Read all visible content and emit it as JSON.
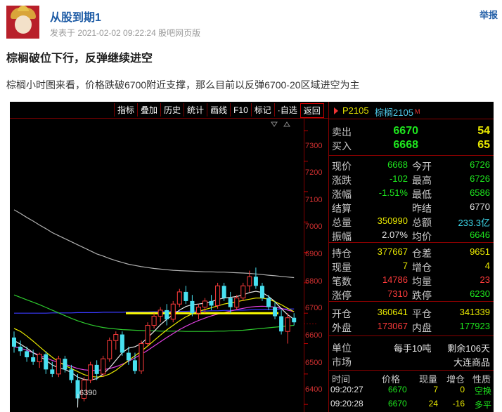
{
  "post": {
    "username": "从股到期1",
    "meta": "发表于 2021-02-02 09:22:24 股吧网页版",
    "report": "举报",
    "title": "棕榈破位下行，反弹继续进空",
    "content": "棕榈小时图来看，价格跌破6700附近支撑，那么目前以反弹6700-20区域进空为主"
  },
  "chart": {
    "toolbar": [
      "指标",
      "叠加",
      "历史",
      "统计",
      "画线",
      "F10",
      "标记",
      "·自选",
      "返回"
    ],
    "active_tool": "返回",
    "y_ticks": [
      "7300",
      "7200",
      "7100",
      "7000",
      "6900",
      "6800",
      "6700",
      "6600",
      "6500",
      "6400"
    ],
    "low_marker": "6390",
    "colors": {
      "bg": "#000000",
      "up": "#ff3b3b",
      "down": "#48e0f0",
      "grid": "#800000",
      "support": "#ffff00"
    }
  },
  "chart_data": {
    "type": "candlestick",
    "y_ticks": [
      7300,
      7200,
      7100,
      7000,
      6900,
      6800,
      6700,
      6600,
      6500,
      6400
    ],
    "ylim": [
      6375,
      7340
    ],
    "support_line": 6700,
    "low_annotation": 6390,
    "candles": [
      {
        "o": 6620,
        "h": 6640,
        "l": 6570,
        "c": 6590
      },
      {
        "o": 6590,
        "h": 6610,
        "l": 6560,
        "c": 6575
      },
      {
        "o": 6575,
        "h": 6590,
        "l": 6540,
        "c": 6555
      },
      {
        "o": 6555,
        "h": 6580,
        "l": 6530,
        "c": 6540
      },
      {
        "o": 6540,
        "h": 6570,
        "l": 6520,
        "c": 6565
      },
      {
        "o": 6565,
        "h": 6575,
        "l": 6500,
        "c": 6515
      },
      {
        "o": 6515,
        "h": 6540,
        "l": 6490,
        "c": 6500
      },
      {
        "o": 6500,
        "h": 6560,
        "l": 6490,
        "c": 6550
      },
      {
        "o": 6550,
        "h": 6560,
        "l": 6505,
        "c": 6515
      },
      {
        "o": 6515,
        "h": 6530,
        "l": 6470,
        "c": 6480
      },
      {
        "o": 6480,
        "h": 6500,
        "l": 6390,
        "c": 6420
      },
      {
        "o": 6420,
        "h": 6490,
        "l": 6410,
        "c": 6480
      },
      {
        "o": 6480,
        "h": 6540,
        "l": 6470,
        "c": 6530
      },
      {
        "o": 6530,
        "h": 6545,
        "l": 6480,
        "c": 6500
      },
      {
        "o": 6500,
        "h": 6560,
        "l": 6490,
        "c": 6550
      },
      {
        "o": 6550,
        "h": 6620,
        "l": 6540,
        "c": 6610
      },
      {
        "o": 6610,
        "h": 6640,
        "l": 6580,
        "c": 6630
      },
      {
        "o": 6630,
        "h": 6640,
        "l": 6560,
        "c": 6570
      },
      {
        "o": 6570,
        "h": 6590,
        "l": 6530,
        "c": 6545
      },
      {
        "o": 6545,
        "h": 6570,
        "l": 6500,
        "c": 6510
      },
      {
        "o": 6510,
        "h": 6610,
        "l": 6500,
        "c": 6600
      },
      {
        "o": 6600,
        "h": 6670,
        "l": 6590,
        "c": 6660
      },
      {
        "o": 6660,
        "h": 6700,
        "l": 6650,
        "c": 6690
      },
      {
        "o": 6690,
        "h": 6720,
        "l": 6670,
        "c": 6710
      },
      {
        "o": 6710,
        "h": 6730,
        "l": 6660,
        "c": 6680
      },
      {
        "o": 6680,
        "h": 6740,
        "l": 6670,
        "c": 6730
      },
      {
        "o": 6730,
        "h": 6780,
        "l": 6720,
        "c": 6770
      },
      {
        "o": 6770,
        "h": 6790,
        "l": 6730,
        "c": 6740
      },
      {
        "o": 6740,
        "h": 6760,
        "l": 6690,
        "c": 6700
      },
      {
        "o": 6700,
        "h": 6730,
        "l": 6680,
        "c": 6720
      },
      {
        "o": 6720,
        "h": 6750,
        "l": 6700,
        "c": 6740
      },
      {
        "o": 6740,
        "h": 6760,
        "l": 6710,
        "c": 6725
      },
      {
        "o": 6725,
        "h": 6800,
        "l": 6715,
        "c": 6790
      },
      {
        "o": 6790,
        "h": 6800,
        "l": 6740,
        "c": 6750
      },
      {
        "o": 6750,
        "h": 6770,
        "l": 6700,
        "c": 6720
      },
      {
        "o": 6720,
        "h": 6760,
        "l": 6710,
        "c": 6750
      },
      {
        "o": 6750,
        "h": 6800,
        "l": 6740,
        "c": 6790
      },
      {
        "o": 6790,
        "h": 6840,
        "l": 6770,
        "c": 6820
      },
      {
        "o": 6820,
        "h": 6850,
        "l": 6780,
        "c": 6790
      },
      {
        "o": 6790,
        "h": 6800,
        "l": 6740,
        "c": 6750
      },
      {
        "o": 6750,
        "h": 6760,
        "l": 6710,
        "c": 6720
      },
      {
        "o": 6720,
        "h": 6740,
        "l": 6680,
        "c": 6690
      },
      {
        "o": 6690,
        "h": 6710,
        "l": 6630,
        "c": 6640
      },
      {
        "o": 6640,
        "h": 6700,
        "l": 6600,
        "c": 6685
      },
      {
        "o": 6685,
        "h": 6700,
        "l": 6660,
        "c": 6670
      }
    ],
    "ma_lines": [
      {
        "color": "#b0b0b0",
        "values": [
          7040,
          7028,
          7015,
          7003,
          6990,
          6978,
          6965,
          6955,
          6945,
          6935,
          6925,
          6915,
          6905,
          6895,
          6888,
          6880,
          6873,
          6867,
          6861,
          6857,
          6853,
          6850,
          6847,
          6845,
          6843,
          6841,
          6840,
          6839,
          6838,
          6837,
          6836,
          6836,
          6835,
          6835,
          6834,
          6833,
          6832,
          6831,
          6829,
          6827,
          6825,
          6823,
          6821,
          6819,
          6817
        ]
      },
      {
        "color": "#3a3aff",
        "values": [
          6700,
          6700,
          6700,
          6700,
          6700,
          6700,
          6701,
          6701,
          6701,
          6701,
          6702,
          6702,
          6702,
          6702,
          6703,
          6703,
          6703,
          6703,
          6704,
          6704,
          6704,
          6704,
          6705,
          6705,
          6705,
          6706,
          6706,
          6706,
          6707,
          6707,
          6707,
          6708,
          6708,
          6709,
          6709,
          6710,
          6710,
          6711,
          6712,
          6712,
          6713,
          6713,
          6714,
          6714,
          6714
        ]
      },
      {
        "color": "#2ecc2e",
        "values": [
          6760,
          6752,
          6744,
          6736,
          6728,
          6719,
          6710,
          6701,
          6692,
          6683,
          6675,
          6668,
          6662,
          6657,
          6653,
          6650,
          6648,
          6646,
          6645,
          6644,
          6643,
          6642,
          6642,
          6641,
          6641,
          6641,
          6641,
          6640,
          6640,
          6640,
          6640,
          6640,
          6641,
          6641,
          6642,
          6643,
          6644,
          6646,
          6648,
          6650,
          6652,
          6654,
          6656,
          6658,
          6660
        ]
      },
      {
        "color": "#e040e0",
        "values": [
          6590,
          6585,
          6578,
          6570,
          6562,
          6553,
          6545,
          6538,
          6532,
          6525,
          6518,
          6514,
          6512,
          6512,
          6514,
          6518,
          6524,
          6532,
          6542,
          6553,
          6565,
          6578,
          6592,
          6606,
          6620,
          6633,
          6646,
          6657,
          6667,
          6676,
          6684,
          6691,
          6697,
          6702,
          6707,
          6712,
          6716,
          6720,
          6722,
          6723,
          6722,
          6720,
          6716,
          6710,
          6705
        ]
      },
      {
        "color": "#e8e8e8",
        "values": [
          6610,
          6598,
          6585,
          6570,
          6558,
          6545,
          6530,
          6520,
          6515,
          6505,
          6490,
          6482,
          6480,
          6485,
          6500,
          6520,
          6545,
          6570,
          6585,
          6590,
          6600,
          6620,
          6640,
          6662,
          6680,
          6695,
          6710,
          6722,
          6728,
          6730,
          6733,
          6738,
          6745,
          6750,
          6752,
          6755,
          6760,
          6768,
          6772,
          6768,
          6755,
          6738,
          6715,
          6695,
          6680
        ]
      },
      {
        "color": "#e8e800",
        "values": [
          6650,
          6640,
          6625,
          6608,
          6590,
          6572,
          6555,
          6540,
          6528,
          6518,
          6508,
          6498,
          6492,
          6490,
          6492,
          6500,
          6512,
          6528,
          6545,
          6560,
          6575,
          6592,
          6610,
          6628,
          6645,
          6660,
          6675,
          6688,
          6698,
          6706,
          6712,
          6718,
          6724,
          6730,
          6734,
          6738,
          6742,
          6746,
          6750,
          6750,
          6746,
          6738,
          6728,
          6716,
          6705
        ]
      }
    ]
  },
  "quote": {
    "symbol": "P2105",
    "name": "棕榈2105",
    "mark": "M",
    "sell_label": "卖出",
    "sell_price": "6670",
    "sell_vol": "54",
    "buy_label": "买入",
    "buy_price": "6668",
    "buy_vol": "65",
    "rows1": [
      {
        "l1": "现价",
        "v1": "6668",
        "c1": "g",
        "l2": "今开",
        "v2": "6726",
        "c2": "g"
      },
      {
        "l1": "涨跌",
        "v1": "-102",
        "c1": "g",
        "l2": "最高",
        "v2": "6726",
        "c2": "g"
      },
      {
        "l1": "涨幅",
        "v1": "-1.51%",
        "c1": "g",
        "l2": "最低",
        "v2": "6586",
        "c2": "g"
      },
      {
        "l1": "结算",
        "v1": "",
        "c1": "w",
        "l2": "昨结",
        "v2": "6770",
        "c2": "w"
      },
      {
        "l1": "总量",
        "v1": "350990",
        "c1": "y",
        "l2": "总额",
        "v2": "233.3亿",
        "c2": "c"
      },
      {
        "l1": "振幅",
        "v1": "2.07%",
        "c1": "w",
        "l2": "均价",
        "v2": "6646",
        "c2": "g"
      }
    ],
    "rows2": [
      {
        "l1": "持仓",
        "v1": "377667",
        "c1": "y",
        "l2": "仓差",
        "v2": "9651",
        "c2": "y"
      },
      {
        "l1": "现量",
        "v1": "7",
        "c1": "y",
        "l2": "增仓",
        "v2": "4",
        "c2": "y"
      },
      {
        "l1": "笔数",
        "v1": "14786",
        "c1": "r",
        "l2": "均量",
        "v2": "23",
        "c2": "r"
      },
      {
        "l1": "涨停",
        "v1": "7310",
        "c1": "r",
        "l2": "跌停",
        "v2": "6230",
        "c2": "g"
      }
    ],
    "rows3": [
      {
        "l1": "开仓",
        "v1": "360641",
        "c1": "y",
        "l2": "平仓",
        "v2": "341339",
        "c2": "y"
      },
      {
        "l1": "外盘",
        "v1": "173067",
        "c1": "r",
        "l2": "内盘",
        "v2": "177923",
        "c2": "g"
      }
    ],
    "unit_label": "单位",
    "unit_value": "每手10吨",
    "remain_label": "剩余106天",
    "market_label": "市场",
    "market_value": "大连商品",
    "tick_headers": [
      "时间",
      "价格",
      "现量",
      "增仓",
      "性质"
    ],
    "ticks": [
      {
        "time": "09:20:27",
        "price": "6670",
        "vol": "7",
        "oi": "0",
        "nature": "空换"
      },
      {
        "time": "09:20:28",
        "price": "6670",
        "vol": "24",
        "oi": "-16",
        "nature": "多平"
      }
    ]
  }
}
